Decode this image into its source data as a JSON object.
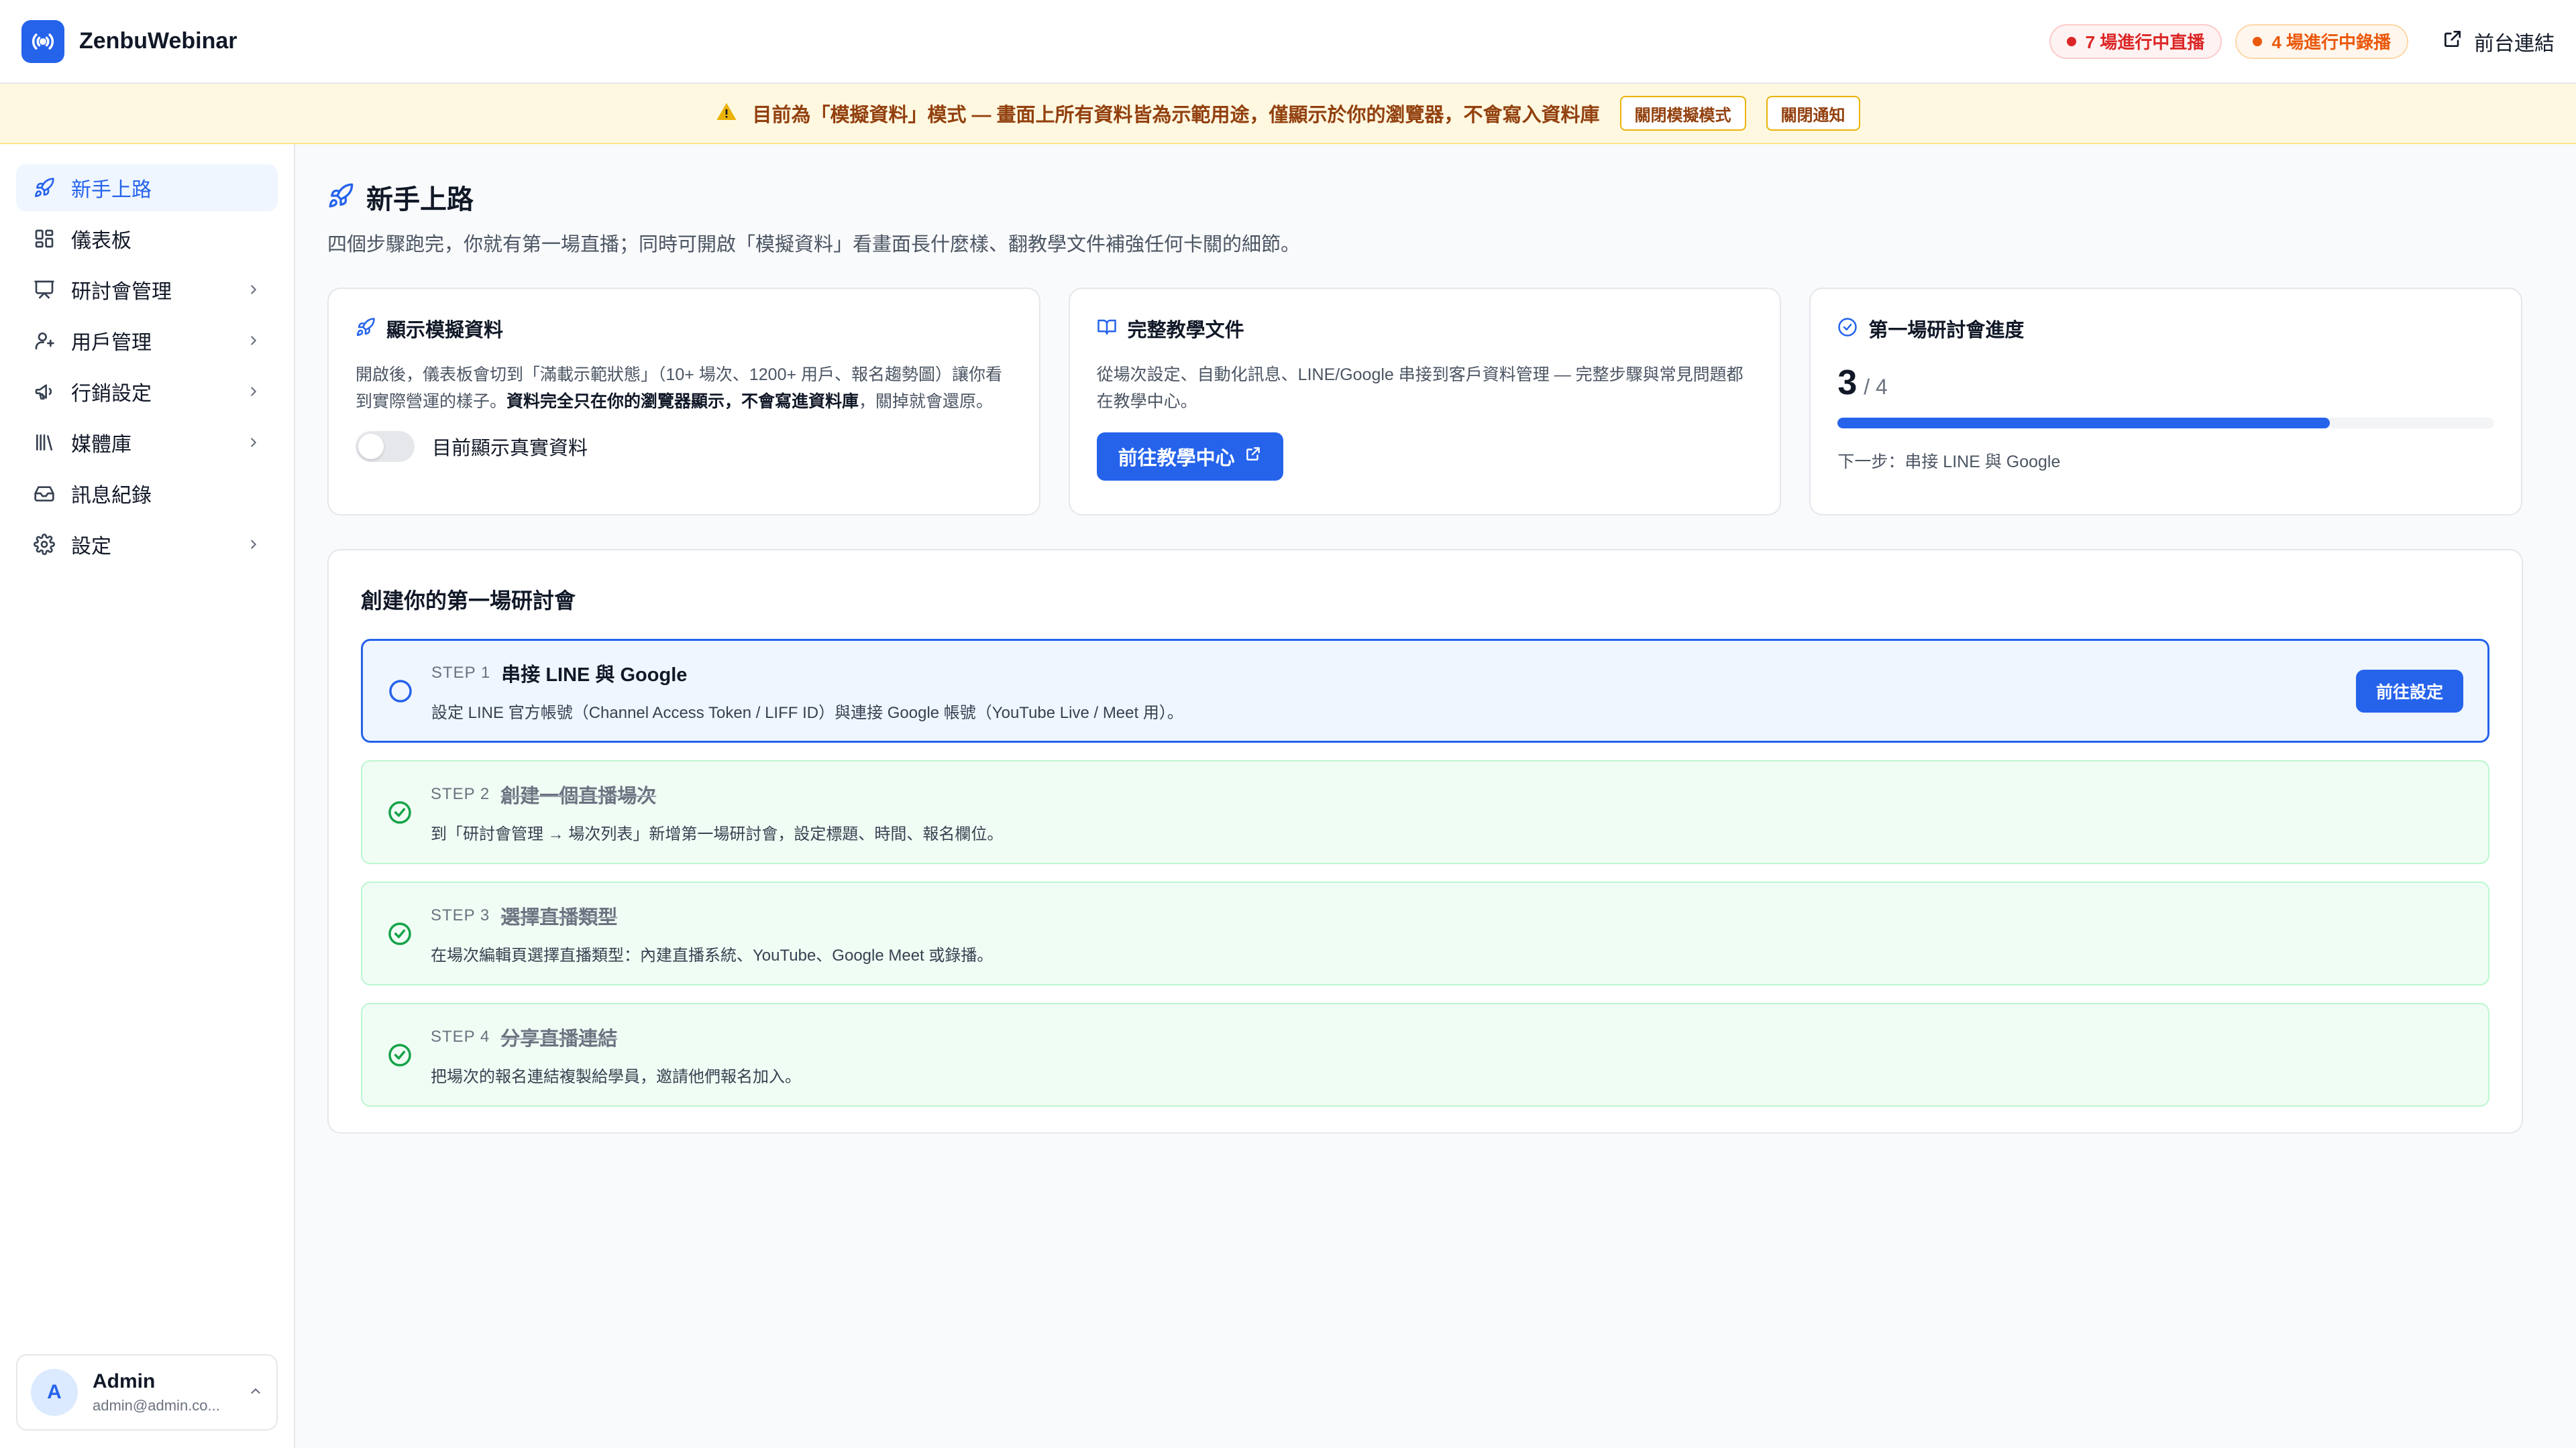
{
  "app": {
    "name": "ZenbuWebinar",
    "logo_icon": "broadcast-icon",
    "accent": "#2563eb"
  },
  "header": {
    "live_badge": "7 場進行中直播",
    "rec_badge": "4 場進行中錄播",
    "front_link": "前台連結"
  },
  "banner": {
    "icon": "warning-icon",
    "text": "目前為「模擬資料」模式 — 畫面上所有資料皆為示範用途，僅顯示於你的瀏覽器，不會寫入資料庫",
    "close_mock_button": "關閉模擬模式",
    "close_notice_button": "關閉通知"
  },
  "sidebar": {
    "items": [
      {
        "label": "新手上路",
        "icon": "rocket-icon",
        "active": true,
        "has_submenu": false
      },
      {
        "label": "儀表板",
        "icon": "dashboard-grid-icon",
        "active": false,
        "has_submenu": false
      },
      {
        "label": "研討會管理",
        "icon": "presentation-icon",
        "active": false,
        "has_submenu": true
      },
      {
        "label": "用戶管理",
        "icon": "users-icon",
        "active": false,
        "has_submenu": true
      },
      {
        "label": "行銷設定",
        "icon": "megaphone-icon",
        "active": false,
        "has_submenu": true
      },
      {
        "label": "媒體庫",
        "icon": "library-icon",
        "active": false,
        "has_submenu": true
      },
      {
        "label": "訊息紀錄",
        "icon": "inbox-icon",
        "active": false,
        "has_submenu": false
      },
      {
        "label": "設定",
        "icon": "gear-icon",
        "active": false,
        "has_submenu": true
      }
    ],
    "user": {
      "initial": "A",
      "name": "Admin",
      "email": "admin@admin.co..."
    }
  },
  "page": {
    "title": "新手上路",
    "subtitle": "四個步驟跑完，你就有第一場直播；同時可開啟「模擬資料」看畫面長什麼樣、翻教學文件補強任何卡關的細節。"
  },
  "cards": {
    "mock": {
      "title": "顯示模擬資料",
      "desc_plain": "開啟後，儀表板會切到「滿載示範狀態」（10+ 場次、1200+ 用戶、報名趨勢圖）讓你看到實際營運的樣子。",
      "desc_bold": "資料完全只在你的瀏覽器顯示，不會寫進資料庫",
      "desc_tail": "，關掉就會還原。",
      "toggle_on": false,
      "toggle_label": "目前顯示真實資料"
    },
    "docs": {
      "title": "完整教學文件",
      "desc": "從場次設定、自動化訊息、LINE/Google 串接到客戶資料管理 — 完整步驟與常見問題都在教學中心。",
      "button": "前往教學中心"
    },
    "progress": {
      "title": "第一場研討會進度",
      "current": "3",
      "total": "/ 4",
      "fraction": 0.75,
      "next": "下一步：串接 LINE 與 Google"
    }
  },
  "steps": {
    "title": "創建你的第一場研討會",
    "items": [
      {
        "step": "STEP  1",
        "name": "串接 LINE 與 Google",
        "desc": "設定 LINE 官方帳號（Channel Access Token / LIFF ID）與連接 Google 帳號（YouTube Live / Meet 用）。",
        "done": false,
        "button": "前往設定"
      },
      {
        "step": "STEP  2",
        "name": "創建一個直播場次",
        "desc": "到「研討會管理 → 場次列表」新增第一場研討會，設定標題、時間、報名欄位。",
        "done": true
      },
      {
        "step": "STEP  3",
        "name": "選擇直播類型",
        "desc": "在場次編輯頁選擇直播類型：內建直播系統、YouTube、Google Meet 或錄播。",
        "done": true
      },
      {
        "step": "STEP  4",
        "name": "分享直播連結",
        "desc": "把場次的報名連結複製給學員，邀請他們報名加入。",
        "done": true
      }
    ]
  }
}
